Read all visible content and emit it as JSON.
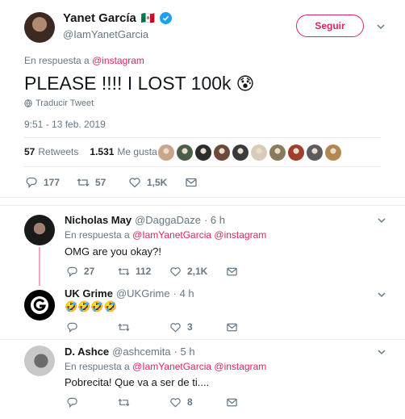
{
  "tweet": {
    "author_name": "Yanet García",
    "flag": "🇲🇽",
    "handle": "@IamYanetGarcia",
    "follow_label": "Seguir",
    "reply_prefix": "En respuesta a",
    "reply_to": "@instagram",
    "text": "PLEASE !!!! I LOST 100k",
    "emoji": "😰",
    "translate_label": "Traducir Tweet",
    "timestamp": "9:51 - 13 feb. 2019",
    "retweets_count": "57",
    "retweets_label": "Retweets",
    "likes_count": "1.531",
    "likes_label": "Me gusta",
    "likers": [
      "#c9a58c",
      "#4a5d4a",
      "#2c2c2c",
      "#6b4a3a",
      "#3a3a3a",
      "#d9cbb8",
      "#8a7a5c",
      "#a0402a",
      "#5c5c5c",
      "#b08850"
    ],
    "actions": {
      "replies": "177",
      "retweets": "57",
      "likes": "1,5K"
    }
  },
  "replies": [
    {
      "name": "Nicholas May",
      "handle": "@DaggaDaze",
      "time": "· 6 h",
      "reply_prefix": "En respuesta a",
      "reply_to_1": "@IamYanetGarcia",
      "reply_to_2": "@instagram",
      "text": "OMG are you okay?!",
      "actions": {
        "replies": "27",
        "retweets": "112",
        "likes": "2,1K"
      }
    },
    {
      "name": "UK Grime",
      "handle": "@UKGrime",
      "time": "· 4 h",
      "text": "🤣🤣🤣🤣",
      "actions": {
        "replies": "",
        "retweets": "",
        "likes": "3"
      }
    },
    {
      "name": "D. Ashce",
      "handle": "@ashcemita",
      "time": "· 5 h",
      "reply_prefix": "En respuesta a",
      "reply_to_1": "@IamYanetGarcia",
      "reply_to_2": "@instagram",
      "text": "Pobrecita! Que va a ser de ti....",
      "actions": {
        "replies": "",
        "retweets": "",
        "likes": "8"
      }
    }
  ],
  "colors": {
    "accent": "#e0245e",
    "gray": "#657786",
    "verified": "#1da1f2"
  }
}
